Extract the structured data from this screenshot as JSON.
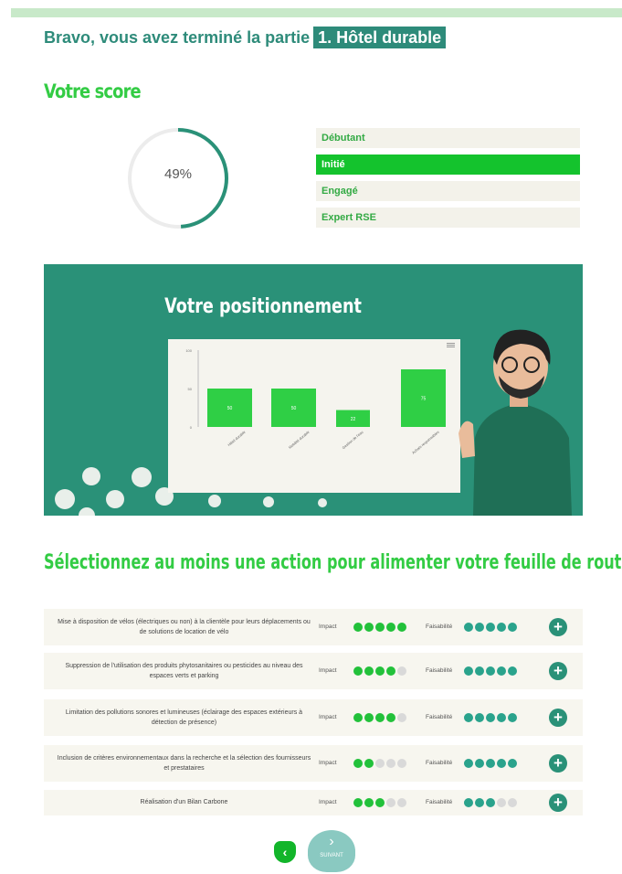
{
  "header": {
    "prefix": "Bravo, vous avez terminé la partie",
    "part_tag": "1. Hôtel durable"
  },
  "score": {
    "title": "Votre score",
    "value_text": "49%",
    "value_fraction": 0.49
  },
  "levels": [
    {
      "label": "Débutant",
      "active": false
    },
    {
      "label": "Initié",
      "active": true
    },
    {
      "label": "Engagé",
      "active": false
    },
    {
      "label": "Expert RSE",
      "active": false
    }
  ],
  "positioning": {
    "title": "Votre positionnement",
    "menu_icon": "hamburger-icon"
  },
  "chart_data": {
    "type": "bar",
    "categories": [
      "Hôtel durable",
      "Mobilité durable",
      "Gestion de l'eau",
      "Achats responsables"
    ],
    "values": [
      50,
      50,
      22,
      75
    ],
    "y_ticks": [
      "100",
      "50",
      "0"
    ],
    "ylim": [
      0,
      100
    ],
    "bar_color": "#2fcf45"
  },
  "actions": {
    "title": "Sélectionnez au moins une action pour alimenter votre feuille de route !",
    "impact_label": "Impact",
    "feasibility_label": "Faisabilité",
    "items": [
      {
        "text": "Mise à disposition de vélos (électriques ou non) à la clientèle pour leurs déplacements ou de solutions de location de vélo",
        "impact": 5,
        "feasibility": 5
      },
      {
        "text": "Suppression de l'utilisation des produits phytosanitaires ou pesticides au niveau des espaces verts et parking",
        "impact": 4,
        "feasibility": 5
      },
      {
        "text": "Limitation des pollutions sonores et lumineuses (éclairage des espaces extérieurs à détection de présence)",
        "impact": 4,
        "feasibility": 5
      },
      {
        "text": "Inclusion de critères environnementaux dans la recherche et la sélection des fournisseurs et prestataires",
        "impact": 2,
        "feasibility": 5
      },
      {
        "text": "Réalisation d'un Bilan Carbone",
        "impact": 3,
        "feasibility": 3
      }
    ]
  },
  "nav": {
    "back_icon": "chevron-left-icon",
    "next_icon": "chevron-right-icon",
    "next_label": "SUIVANT"
  },
  "colors": {
    "accent": "#2a9178",
    "green": "#33cc44",
    "active_level": "#14c32d"
  }
}
